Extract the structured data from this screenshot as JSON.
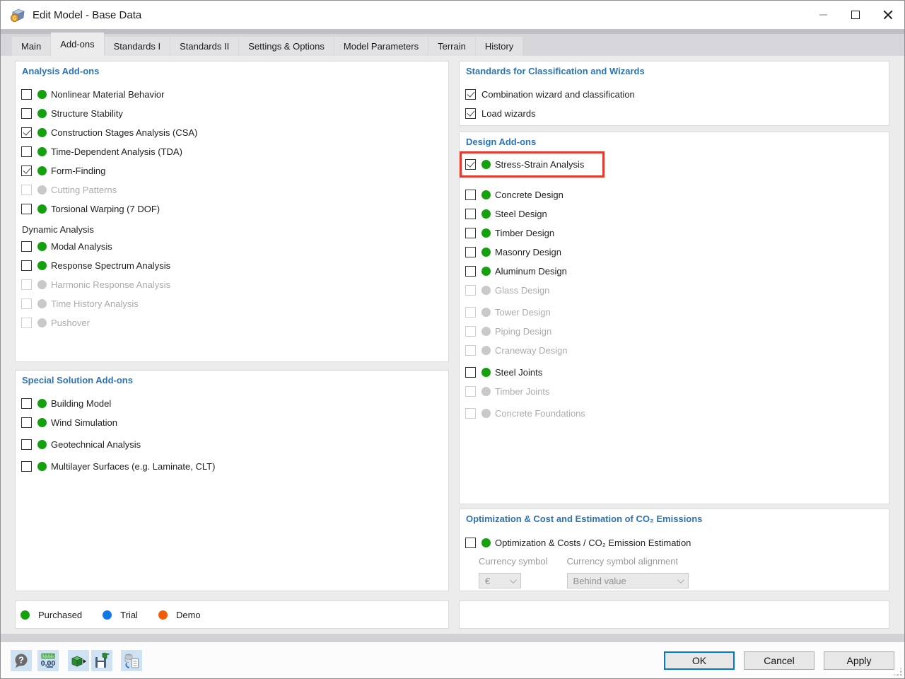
{
  "colors": {
    "header-blue": "#2e74b5",
    "green": "#13a10e",
    "gray-dot": "#c9c9c9",
    "blue": "#0f7ae5",
    "orange": "#f25c05",
    "red": "#e8392f",
    "accent": "#0078d4"
  },
  "window": {
    "title": "Edit Model - Base Data"
  },
  "icons": {
    "app": "model-cube-6-icon",
    "window_controls": [
      "minimize-icon",
      "maximize-icon",
      "close-icon"
    ],
    "toolbar": [
      "help-icon",
      "units-decimal-places-icon",
      "apply-template-icon",
      "save-as-template-icon",
      "import-export-icon"
    ]
  },
  "tabs": [
    {
      "label": "Main"
    },
    {
      "label": "Add-ons",
      "selected": true
    },
    {
      "label": "Standards I"
    },
    {
      "label": "Standards II"
    },
    {
      "label": "Settings & Options"
    },
    {
      "label": "Model Parameters"
    },
    {
      "label": "Terrain"
    },
    {
      "label": "History"
    }
  ],
  "analysis": {
    "title": "Analysis Add-ons",
    "items": [
      {
        "label": "Nonlinear Material Behavior",
        "checked": false,
        "enabled": true,
        "dot": "green"
      },
      {
        "label": "Structure Stability",
        "checked": false,
        "enabled": true,
        "dot": "green"
      },
      {
        "label": "Construction Stages Analysis (CSA)",
        "checked": true,
        "enabled": true,
        "dot": "green"
      },
      {
        "label": "Time-Dependent Analysis (TDA)",
        "checked": false,
        "enabled": true,
        "dot": "green"
      },
      {
        "label": "Form-Finding",
        "checked": true,
        "enabled": true,
        "dot": "green"
      },
      {
        "label": "Cutting Patterns",
        "checked": false,
        "enabled": false,
        "dot": "gray"
      },
      {
        "label": "Torsional Warping (7 DOF)",
        "checked": false,
        "enabled": true,
        "dot": "green"
      }
    ],
    "dynamic_title": "Dynamic Analysis",
    "dynamic_items": [
      {
        "label": "Modal Analysis",
        "checked": false,
        "enabled": true,
        "dot": "green"
      },
      {
        "label": "Response Spectrum Analysis",
        "checked": false,
        "enabled": true,
        "dot": "green"
      },
      {
        "label": "Harmonic Response Analysis",
        "checked": false,
        "enabled": false,
        "dot": "gray"
      },
      {
        "label": "Time History Analysis",
        "checked": false,
        "enabled": false,
        "dot": "gray"
      },
      {
        "label": "Pushover",
        "checked": false,
        "enabled": false,
        "dot": "gray"
      }
    ]
  },
  "special": {
    "title": "Special Solution Add-ons",
    "items": [
      {
        "label": "Building Model",
        "checked": false,
        "enabled": true,
        "dot": "green"
      },
      {
        "label": "Wind Simulation",
        "checked": false,
        "enabled": true,
        "dot": "green"
      },
      {
        "label": "Geotechnical Analysis",
        "checked": false,
        "enabled": true,
        "dot": "green",
        "gap": true
      },
      {
        "label": "Multilayer Surfaces (e.g. Laminate, CLT)",
        "checked": false,
        "enabled": true,
        "dot": "green",
        "gap": true
      }
    ]
  },
  "legend": {
    "items": [
      {
        "label": "Purchased",
        "color_key": "green"
      },
      {
        "label": "Trial",
        "color_key": "blue"
      },
      {
        "label": "Demo",
        "color_key": "orange"
      }
    ]
  },
  "standards": {
    "title": "Standards for Classification and Wizards",
    "items": [
      {
        "label": "Combination wizard and classification",
        "checked": true,
        "enabled": true,
        "dot": null
      },
      {
        "label": "Load wizards",
        "checked": true,
        "enabled": true,
        "dot": null
      }
    ]
  },
  "design": {
    "title": "Design Add-ons",
    "items": [
      {
        "label": "Stress-Strain Analysis",
        "checked": true,
        "enabled": true,
        "dot": "green",
        "highlight": true
      },
      {
        "label": "Concrete Design",
        "checked": false,
        "enabled": true,
        "dot": "green"
      },
      {
        "label": "Steel Design",
        "checked": false,
        "enabled": true,
        "dot": "green"
      },
      {
        "label": "Timber Design",
        "checked": false,
        "enabled": true,
        "dot": "green"
      },
      {
        "label": "Masonry Design",
        "checked": false,
        "enabled": true,
        "dot": "green"
      },
      {
        "label": "Aluminum Design",
        "checked": false,
        "enabled": true,
        "dot": "green"
      },
      {
        "label": "Glass Design",
        "checked": false,
        "enabled": false,
        "dot": "gray"
      },
      {
        "label": "Tower Design",
        "checked": false,
        "enabled": false,
        "dot": "gray",
        "gap": true
      },
      {
        "label": "Piping Design",
        "checked": false,
        "enabled": false,
        "dot": "gray"
      },
      {
        "label": "Craneway Design",
        "checked": false,
        "enabled": false,
        "dot": "gray"
      },
      {
        "label": "Steel Joints",
        "checked": false,
        "enabled": true,
        "dot": "green",
        "gap": true
      },
      {
        "label": "Timber Joints",
        "checked": false,
        "enabled": false,
        "dot": "gray"
      },
      {
        "label": "Concrete Foundations",
        "checked": false,
        "enabled": false,
        "dot": "gray",
        "gap": true
      }
    ]
  },
  "optimization": {
    "title": "Optimization & Cost and Estimation of CO₂ Emissions",
    "items": [
      {
        "label": "Optimization & Costs / CO₂ Emission Estimation",
        "checked": false,
        "enabled": true,
        "dot": "green"
      }
    ],
    "currency_symbol_label": "Currency symbol",
    "currency_symbol_value": "€",
    "alignment_label": "Currency symbol alignment",
    "alignment_value": "Behind value"
  },
  "footer": {
    "ok_label": "OK",
    "cancel_label": "Cancel",
    "apply_label": "Apply"
  }
}
